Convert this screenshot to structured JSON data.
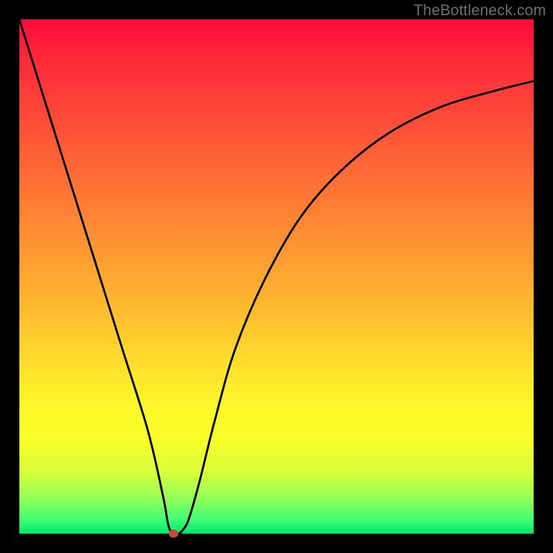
{
  "watermark": "TheBottleneck.com",
  "chart_data": {
    "type": "line",
    "title": "",
    "xlabel": "",
    "ylabel": "",
    "xlim": [
      0,
      100
    ],
    "ylim": [
      0,
      100
    ],
    "grid": false,
    "legend": false,
    "series": [
      {
        "name": "curve",
        "x": [
          0,
          5,
          10,
          15,
          20,
          25,
          28,
          29,
          30,
          31,
          32,
          33,
          35,
          38,
          42,
          48,
          55,
          63,
          72,
          82,
          92,
          100
        ],
        "y": [
          100,
          84,
          68,
          52,
          36,
          20,
          7,
          1.5,
          0,
          0,
          1,
          3,
          10,
          22,
          36,
          50,
          62,
          71,
          78,
          83,
          86,
          88
        ]
      }
    ],
    "marker": {
      "x": 30,
      "y": 0,
      "color": "#c24a3a"
    },
    "background_gradient": {
      "direction": "top-to-bottom",
      "stops": [
        {
          "pos": 0,
          "color": "#ff0a3c"
        },
        {
          "pos": 50,
          "color": "#ff9a33"
        },
        {
          "pos": 75,
          "color": "#fff82a"
        },
        {
          "pos": 100,
          "color": "#00e86a"
        }
      ]
    }
  }
}
